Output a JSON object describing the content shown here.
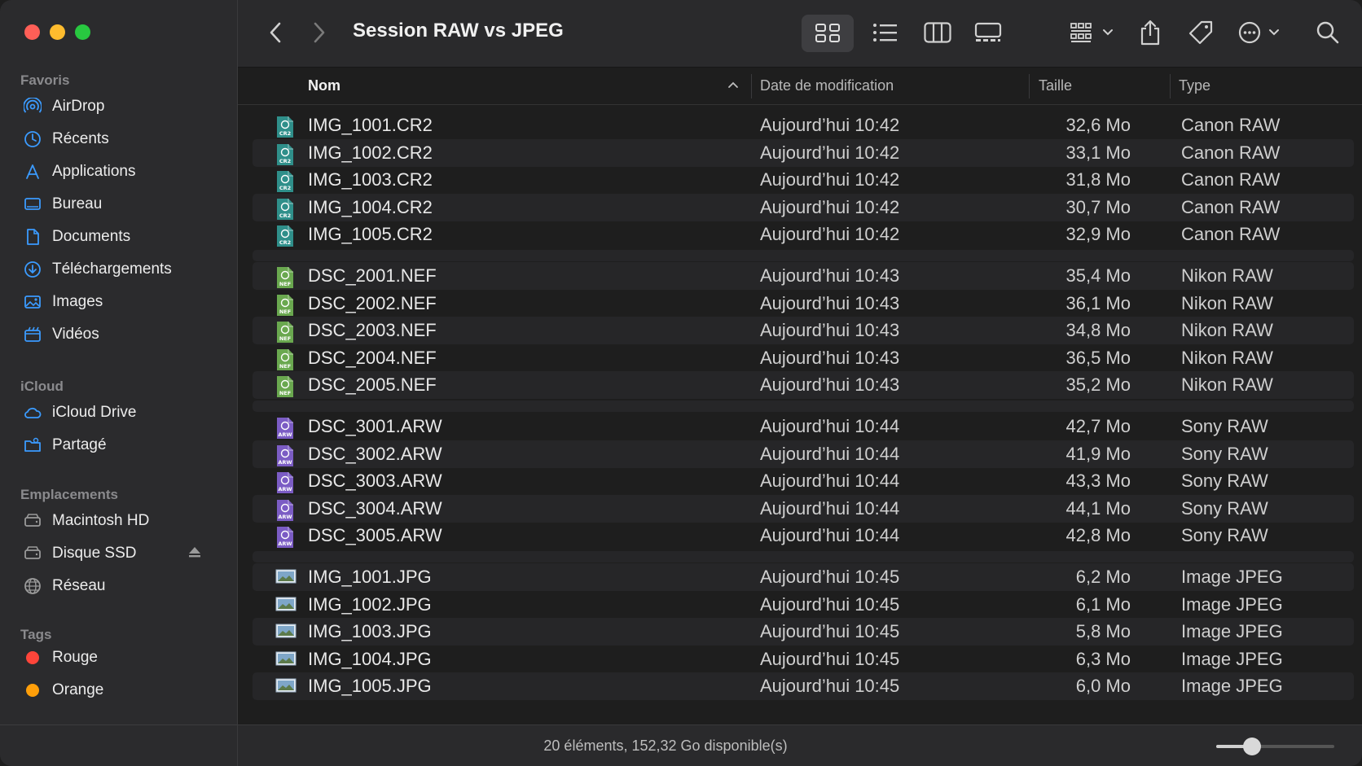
{
  "window": {
    "title": "Session RAW vs JPEG"
  },
  "sidebar": {
    "favorites_title": "Favoris",
    "favorites": [
      {
        "label": "AirDrop",
        "icon": "airdrop-icon"
      },
      {
        "label": "Récents",
        "icon": "clock-icon"
      },
      {
        "label": "Applications",
        "icon": "applications-icon"
      },
      {
        "label": "Bureau",
        "icon": "desktop-icon"
      },
      {
        "label": "Documents",
        "icon": "document-icon"
      },
      {
        "label": "Téléchargements",
        "icon": "download-icon"
      },
      {
        "label": "Images",
        "icon": "photo-icon"
      },
      {
        "label": "Vidéos",
        "icon": "film-icon"
      }
    ],
    "icloud_title": "iCloud",
    "icloud": [
      {
        "label": "iCloud Drive",
        "icon": "cloud-icon"
      },
      {
        "label": "Partagé",
        "icon": "shared-folder-icon"
      }
    ],
    "locations_title": "Emplacements",
    "locations": [
      {
        "label": "Macintosh HD",
        "icon": "disk-icon"
      },
      {
        "label": "Disque SSD",
        "icon": "disk-icon"
      },
      {
        "label": "Réseau",
        "icon": "network-icon"
      }
    ],
    "tags_title": "Tags",
    "tags": [
      {
        "label": "Rouge",
        "color": "#ff453a"
      },
      {
        "label": "Orange",
        "color": "#ff9f0a"
      }
    ],
    "accent_color": "#3b9bff"
  },
  "columns": {
    "name": "Nom",
    "date": "Date de modification",
    "size": "Taille",
    "type": "Type"
  },
  "files": [
    {
      "name": "IMG_1001.CR2",
      "date": "Aujourd’hui 10:42",
      "size": "32,6 Mo",
      "type": "Canon RAW",
      "kind": "cr2"
    },
    {
      "name": "IMG_1002.CR2",
      "date": "Aujourd’hui 10:42",
      "size": "33,1 Mo",
      "type": "Canon RAW",
      "kind": "cr2"
    },
    {
      "name": "IMG_1003.CR2",
      "date": "Aujourd’hui 10:42",
      "size": "31,8 Mo",
      "type": "Canon RAW",
      "kind": "cr2"
    },
    {
      "name": "IMG_1004.CR2",
      "date": "Aujourd’hui 10:42",
      "size": "30,7 Mo",
      "type": "Canon RAW",
      "kind": "cr2"
    },
    {
      "name": "IMG_1005.CR2",
      "date": "Aujourd’hui 10:42",
      "size": "32,9 Mo",
      "type": "Canon RAW",
      "kind": "cr2"
    },
    {
      "name": "DSC_2001.NEF",
      "date": "Aujourd’hui 10:43",
      "size": "35,4 Mo",
      "type": "Nikon RAW",
      "kind": "nef"
    },
    {
      "name": "DSC_2002.NEF",
      "date": "Aujourd’hui 10:43",
      "size": "36,1 Mo",
      "type": "Nikon RAW",
      "kind": "nef"
    },
    {
      "name": "DSC_2003.NEF",
      "date": "Aujourd’hui 10:43",
      "size": "34,8 Mo",
      "type": "Nikon RAW",
      "kind": "nef"
    },
    {
      "name": "DSC_2004.NEF",
      "date": "Aujourd’hui 10:43",
      "size": "36,5 Mo",
      "type": "Nikon RAW",
      "kind": "nef"
    },
    {
      "name": "DSC_2005.NEF",
      "date": "Aujourd’hui 10:43",
      "size": "35,2 Mo",
      "type": "Nikon RAW",
      "kind": "nef"
    },
    {
      "name": "DSC_3001.ARW",
      "date": "Aujourd’hui 10:44",
      "size": "42,7 Mo",
      "type": "Sony RAW",
      "kind": "arw"
    },
    {
      "name": "DSC_3002.ARW",
      "date": "Aujourd’hui 10:44",
      "size": "41,9 Mo",
      "type": "Sony RAW",
      "kind": "arw"
    },
    {
      "name": "DSC_3003.ARW",
      "date": "Aujourd’hui 10:44",
      "size": "43,3 Mo",
      "type": "Sony RAW",
      "kind": "arw"
    },
    {
      "name": "DSC_3004.ARW",
      "date": "Aujourd’hui 10:44",
      "size": "44,1 Mo",
      "type": "Sony RAW",
      "kind": "arw"
    },
    {
      "name": "DSC_3005.ARW",
      "date": "Aujourd’hui 10:44",
      "size": "42,8 Mo",
      "type": "Sony RAW",
      "kind": "arw"
    },
    {
      "name": "IMG_1001.JPG",
      "date": "Aujourd’hui 10:45",
      "size": "6,2 Mo",
      "type": "Image JPEG",
      "kind": "jpg"
    },
    {
      "name": "IMG_1002.JPG",
      "date": "Aujourd’hui 10:45",
      "size": "6,1 Mo",
      "type": "Image JPEG",
      "kind": "jpg"
    },
    {
      "name": "IMG_1003.JPG",
      "date": "Aujourd’hui 10:45",
      "size": "5,8 Mo",
      "type": "Image JPEG",
      "kind": "jpg"
    },
    {
      "name": "IMG_1004.JPG",
      "date": "Aujourd’hui 10:45",
      "size": "6,3 Mo",
      "type": "Image JPEG",
      "kind": "jpg"
    },
    {
      "name": "IMG_1005.JPG",
      "date": "Aujourd’hui 10:45",
      "size": "6,0 Mo",
      "type": "Image JPEG",
      "kind": "jpg"
    }
  ],
  "file_icon_colors": {
    "cr2": "#2f8f8a",
    "nef": "#6aa84f",
    "arw": "#7b5cc4",
    "jpg": "#9bb0c4"
  },
  "file_icon_labels": {
    "cr2": "CR2",
    "nef": "NEF",
    "arw": "ARW"
  },
  "status": {
    "text": "20 éléments, 152,32 Go disponible(s)",
    "zoom_level": 0.3
  }
}
